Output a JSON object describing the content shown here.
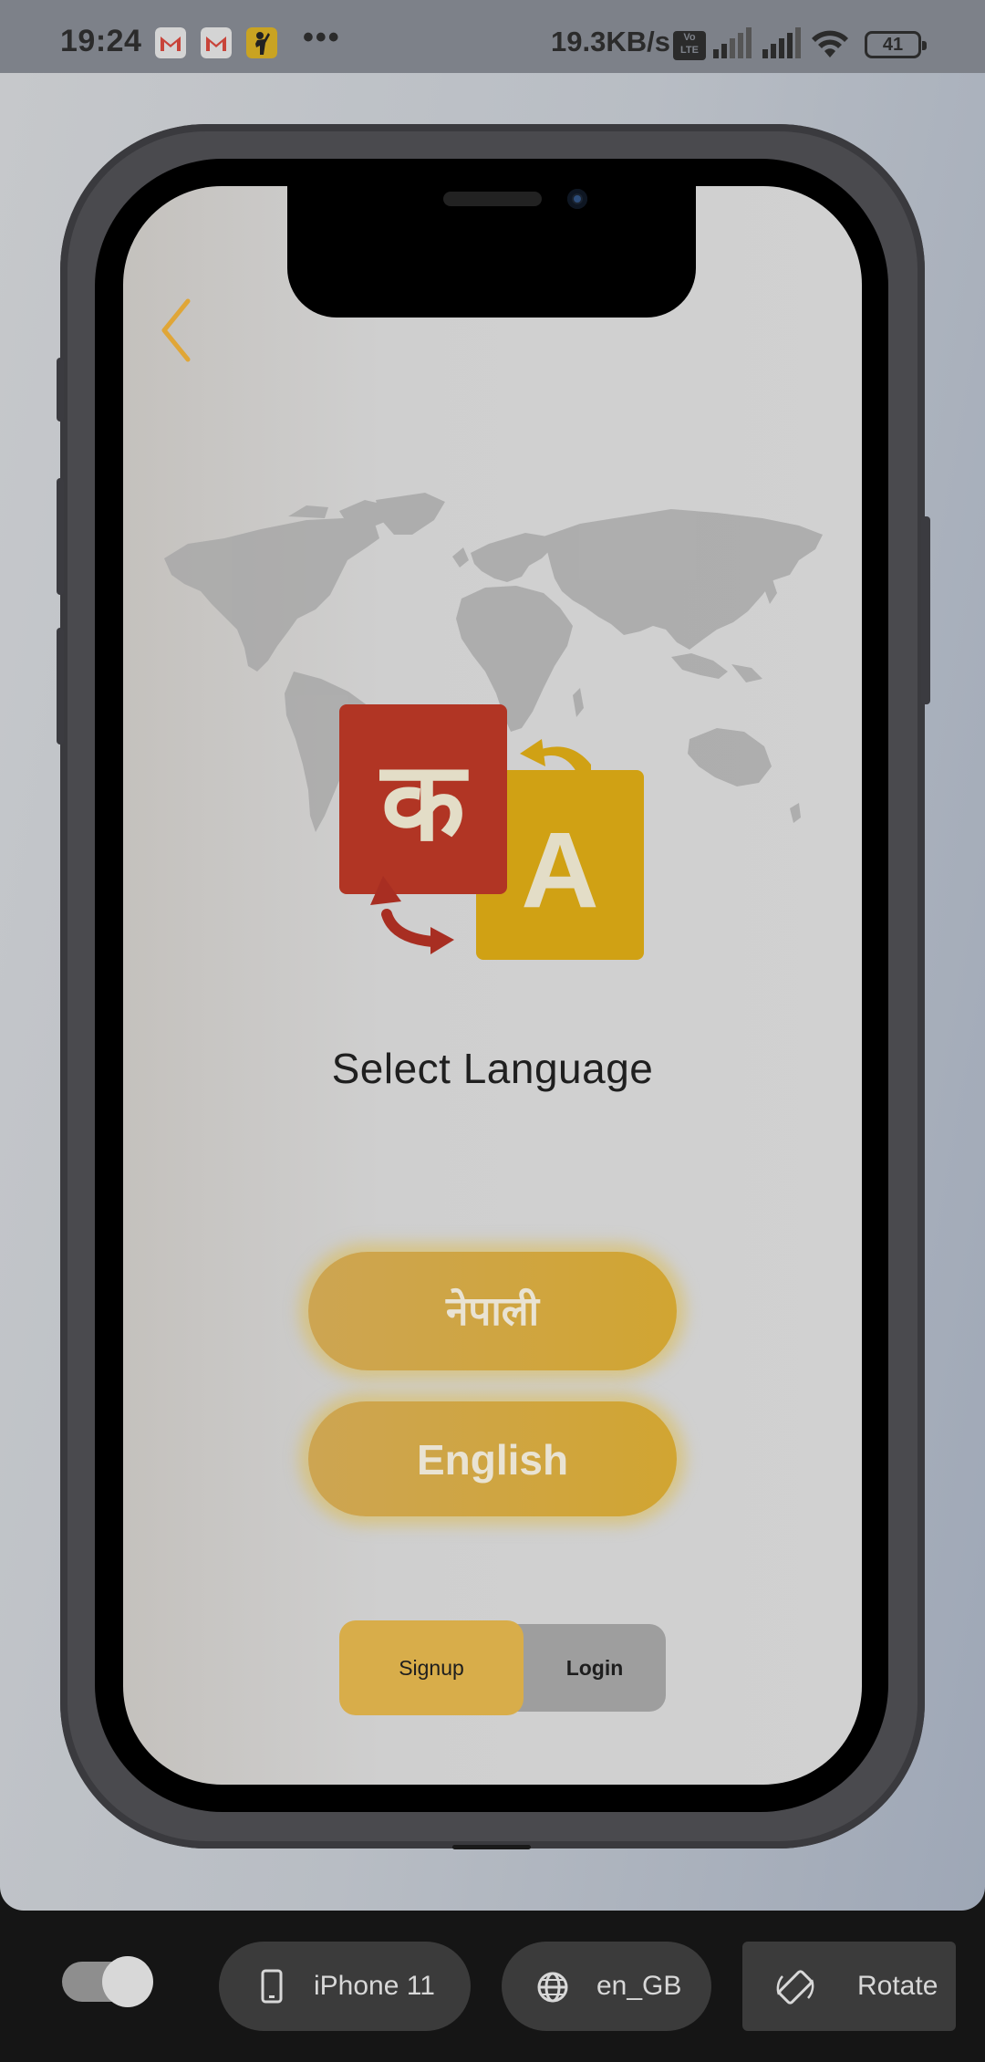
{
  "status_bar": {
    "time": "19:24",
    "dots": "•••",
    "net_speed": "19.3KB/s",
    "volte_top": "Vo",
    "volte_bottom": "LTE",
    "battery": "41",
    "icons": [
      "gmail-icon",
      "gmail-icon",
      "app-notification-icon",
      "volte-icon",
      "signal-icon",
      "signal-icon",
      "wifi-icon",
      "battery-icon"
    ]
  },
  "screen": {
    "back_icon": "chevron-left-icon",
    "illustration": "translate-language-icon",
    "background": "world-map",
    "glyph_devanagari": "क",
    "glyph_latin": "A",
    "title": "Select Language",
    "buttons": {
      "nepali": "नेपाली",
      "english": "English"
    },
    "segmented": {
      "signup": "Signup",
      "login": "Login",
      "selected": "Signup"
    }
  },
  "toolbar": {
    "device": "iPhone 11",
    "locale": "en_GB",
    "rotate": "Rotate",
    "toggle_on": true
  },
  "colors": {
    "accent_gold": "#d1a532",
    "red_tile": "#b13524",
    "yellow_tile": "#d0a114",
    "back_chevron": "#e0a637"
  }
}
